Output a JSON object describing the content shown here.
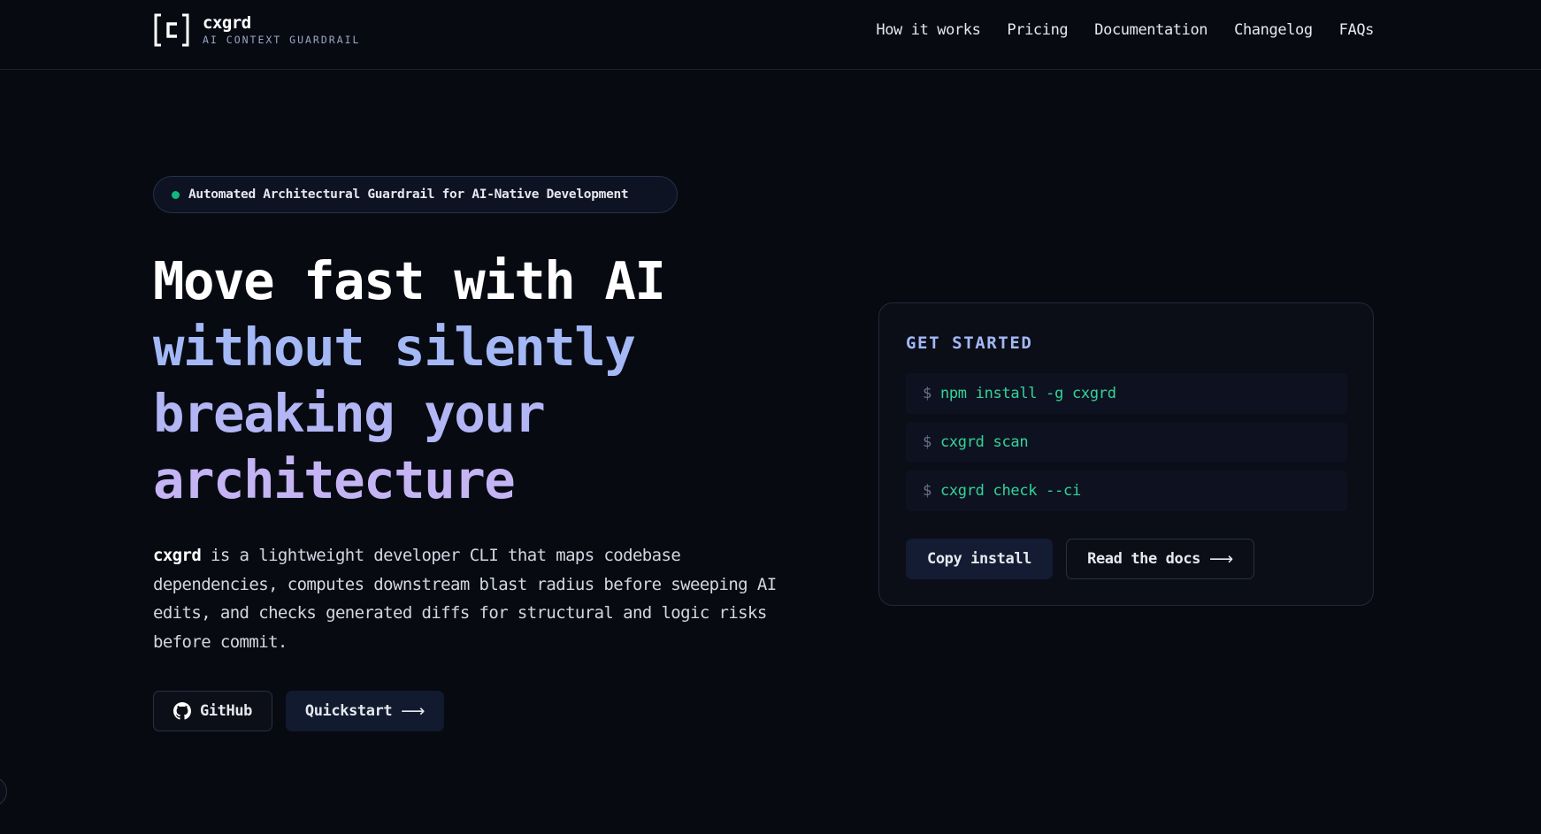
{
  "brand": {
    "name": "cxgrd",
    "tagline": "AI CONTEXT GUARDRAIL",
    "logo_icon": "bracket-c-logo-icon"
  },
  "nav": {
    "links": [
      "How it works",
      "Pricing",
      "Documentation",
      "Changelog",
      "FAQs"
    ]
  },
  "hero": {
    "badge": "Automated Architectural Guardrail for AI-Native Development",
    "badge_dot_color": "#10b981",
    "headline": {
      "line1": "Move fast with AI",
      "line2": "without silently",
      "line3": "breaking your",
      "line4": "architecture"
    },
    "description": {
      "product": "cxgrd",
      "text": " is a lightweight developer CLI that maps codebase dependencies, computes downstream blast radius before sweeping AI edits, and checks generated diffs for structural and logic risks before commit."
    },
    "buttons": {
      "github": "GitHub",
      "github_icon": "github-icon",
      "quickstart": "Quickstart",
      "arrow": "⟶"
    }
  },
  "get_started": {
    "title": "GET STARTED",
    "prompt": "$",
    "commands": [
      "npm install -g cxgrd",
      "cxgrd scan",
      "cxgrd check --ci"
    ],
    "copy_button": "Copy install",
    "docs_button": "Read the docs",
    "arrow": "⟶"
  },
  "colors": {
    "background": "#080a12",
    "accent_blue": "#a3b8f5",
    "accent_purple": "#c5b4f3",
    "command_green": "#34d399"
  }
}
